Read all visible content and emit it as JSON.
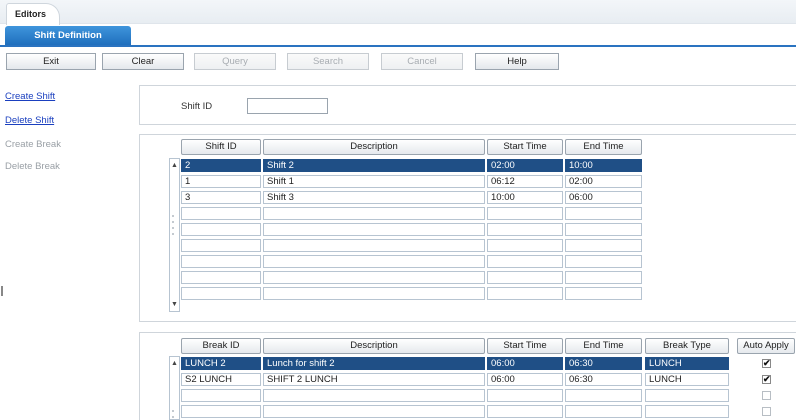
{
  "editors_tab": "Editors",
  "sub_tab": "Shift Definition",
  "toolbar": {
    "exit": "Exit",
    "clear": "Clear",
    "query": "Query",
    "search": "Search",
    "cancel": "Cancel",
    "help": "Help"
  },
  "sidebar": {
    "create_shift": "Create Shift",
    "delete_shift": "Delete Shift",
    "create_break": "Create Break",
    "delete_break": "Delete Break"
  },
  "search": {
    "shift_id_label": "Shift ID",
    "shift_id_value": ""
  },
  "shift_grid": {
    "headers": [
      "Shift ID",
      "Description",
      "Start Time",
      "End Time"
    ],
    "rows": [
      [
        "2",
        "Shift 2",
        "02:00",
        "10:00"
      ],
      [
        "1",
        "Shift 1",
        "06:12",
        "02:00"
      ],
      [
        "3",
        "Shift 3",
        "10:00",
        "06:00"
      ],
      [
        "",
        "",
        "",
        ""
      ],
      [
        "",
        "",
        "",
        ""
      ],
      [
        "",
        "",
        "",
        ""
      ],
      [
        "",
        "",
        "",
        ""
      ],
      [
        "",
        "",
        "",
        ""
      ],
      [
        "",
        "",
        "",
        ""
      ]
    ],
    "selected_row": 0
  },
  "break_grid": {
    "headers": [
      "Break ID",
      "Description",
      "Start Time",
      "End Time",
      "Break Type",
      "Auto Apply"
    ],
    "rows": [
      [
        "LUNCH 2",
        "Lunch for shift 2",
        "06:00",
        "06:30",
        "LUNCH"
      ],
      [
        "S2 LUNCH",
        "SHIFT 2 LUNCH",
        "06:00",
        "06:30",
        "LUNCH"
      ],
      [
        "",
        "",
        "",
        "",
        ""
      ],
      [
        "",
        "",
        "",
        "",
        ""
      ]
    ],
    "auto_apply": [
      true,
      true,
      false,
      false
    ],
    "selected_row": 0
  },
  "colors": {
    "accent": "#2a73c0",
    "selection": "#1f4f86",
    "link": "#1a3fbf"
  }
}
